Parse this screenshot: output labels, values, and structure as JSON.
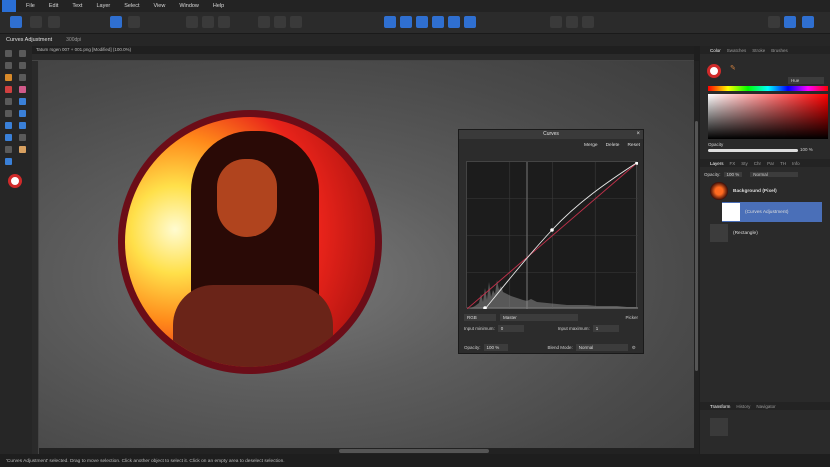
{
  "menubar": {
    "items": [
      "File",
      "Edit",
      "Text",
      "Layer",
      "Select",
      "View",
      "Window",
      "Help"
    ]
  },
  "context_bar": {
    "title": "Curves Adjustment",
    "label": "300dpi"
  },
  "document": {
    "tab_title": "Tatum rsgen 007 + 001.png [Modified] (100.0%)"
  },
  "curves": {
    "title": "Curves",
    "buttons": [
      "Merge",
      "Delete",
      "Reset"
    ],
    "channel": "RGB",
    "mode": "Master",
    "picker_label": "Picker",
    "input_min_label": "Input minimum:",
    "input_min_value": "0",
    "input_max_label": "Input maximum:",
    "input_max_value": "1",
    "opacity_label": "Opacity:",
    "opacity_value": "100 %",
    "blend_label": "Blend Mode:",
    "blend_value": "Normal"
  },
  "color_panel": {
    "tabs": [
      "Color",
      "Swatches",
      "Stroke",
      "Brushes"
    ],
    "mode": "Hue",
    "opacity_label": "Opacity",
    "opacity_value": "100 %"
  },
  "layers_panel": {
    "tabs": [
      "Layers",
      "FX",
      "Sty",
      "Chr",
      "Par",
      "TH",
      "Info"
    ],
    "opacity_label": "Opacity:",
    "opacity_value": "100 %",
    "blend_value": "Normal",
    "layers": [
      {
        "name": "Background (Pixel)"
      },
      {
        "name": "(Curves Adjustment)"
      },
      {
        "name": "(Rectangle)"
      }
    ]
  },
  "bottom_panel": {
    "tabs": [
      "Transform",
      "History",
      "Navigator"
    ]
  },
  "status": {
    "text": "'Curves Adjustment' selected. Drag to move selection. Click another object to select it. Click on an empty area to deselect selection."
  },
  "colors": {
    "accent": "#2f6fd0",
    "ring": "#6b0d18",
    "selected_layer": "#4a6fb8"
  }
}
